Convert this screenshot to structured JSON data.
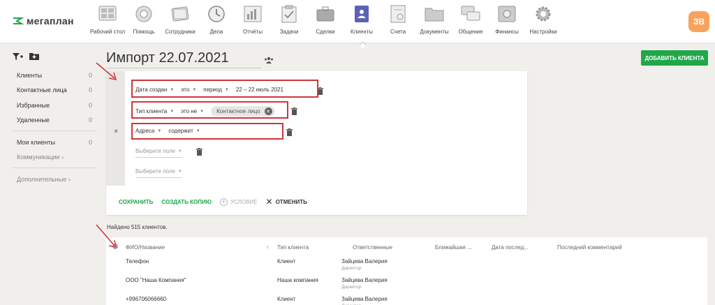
{
  "app": {
    "logo_text": "мегаплан",
    "avatar_initials": "ЗВ",
    "accent_color": "#1fa84a",
    "avatar_color": "#f7a35c"
  },
  "nav": [
    {
      "label": "Рабочий стол",
      "icon": "desktop-icon"
    },
    {
      "label": "Помощь",
      "icon": "lifebuoy-icon"
    },
    {
      "label": "Сотрудники",
      "icon": "employees-icon"
    },
    {
      "label": "Дела",
      "icon": "clock-icon"
    },
    {
      "label": "Отчёты",
      "icon": "reports-icon"
    },
    {
      "label": "Задачи",
      "icon": "tasks-icon"
    },
    {
      "label": "Сделки",
      "icon": "briefcase-icon"
    },
    {
      "label": "Клиенты",
      "icon": "clients-book-icon",
      "active": true
    },
    {
      "label": "Счета",
      "icon": "invoice-icon"
    },
    {
      "label": "Документы",
      "icon": "folder-icon"
    },
    {
      "label": "Общение",
      "icon": "chat-icon"
    },
    {
      "label": "Финансы",
      "icon": "safe-icon"
    },
    {
      "label": "Настройки",
      "icon": "gear-icon"
    }
  ],
  "sidebar": {
    "items": [
      {
        "label": "Клиенты",
        "count": "0"
      },
      {
        "label": "Контактные лица",
        "count": "0"
      },
      {
        "label": "Избранные",
        "count": "0"
      },
      {
        "label": "Удаленные",
        "count": "0"
      },
      {
        "label": "Мои клиенты",
        "count": "0"
      }
    ],
    "communications": "Коммуникации",
    "additional": "Дополнительные"
  },
  "page": {
    "title": "Импорт 22.07.2021",
    "add_client": "ДОБАВИТЬ КЛИЕНТА"
  },
  "filter": {
    "and_label": "и",
    "row1": {
      "field": "Дата создан",
      "op": "это",
      "mode": "период",
      "value": "22 – 22 июль 2021"
    },
    "row2": {
      "field": "Тип клиента",
      "op": "это не",
      "chip": "Контактное лицо"
    },
    "row3": {
      "field": "Адреса",
      "op": "содержит"
    },
    "row4": {
      "placeholder": "Выберите поле"
    },
    "row5": {
      "placeholder": "Выберите поле"
    },
    "actions": {
      "save": "СОХРАНИТЬ",
      "copy": "СОЗДАТЬ КОПИЮ",
      "condition": "УСЛОВИЕ",
      "cancel": "ОТМЕНИТЬ"
    }
  },
  "found_text": "Найдено 515 клиентов.",
  "table": {
    "columns": [
      "ФИО/Название",
      "Тип клиента",
      "Ответственные",
      "Ближайшая ...",
      "Дата послед...",
      "Последний комментарий"
    ],
    "rows": [
      {
        "name": "Телефон",
        "type": "Клиент",
        "resp": "Зайцева Валерия",
        "role": "Директор"
      },
      {
        "name": "ООО \"Наша Компания\"",
        "type": "Наша компания",
        "resp": "Зайцева Валерия",
        "role": "Директор"
      },
      {
        "name": "+996706066660",
        "type": "Клиент",
        "resp": "Зайцева Валерия",
        "role": "Директор"
      }
    ]
  }
}
